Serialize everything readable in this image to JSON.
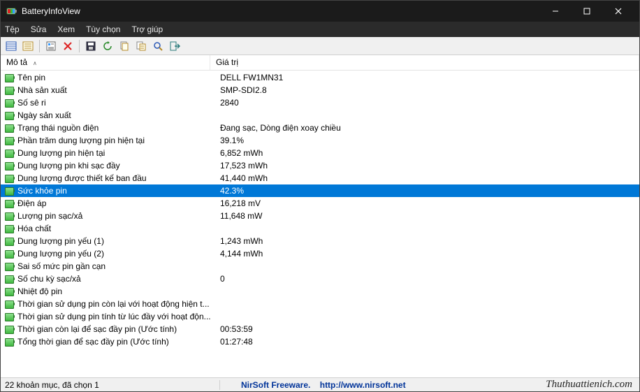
{
  "window": {
    "title": "BatteryInfoView"
  },
  "menu": {
    "file": "Tệp",
    "edit": "Sửa",
    "view": "Xem",
    "options": "Tùy chọn",
    "help": "Trợ giúp"
  },
  "columns": {
    "description": "Mô tả",
    "value": "Giá trị"
  },
  "rows": [
    {
      "desc": "Tên pin",
      "val": "DELL FW1MN31"
    },
    {
      "desc": "Nhà sản xuất",
      "val": "SMP-SDI2.8"
    },
    {
      "desc": "Số sê ri",
      "val": " 2840"
    },
    {
      "desc": "Ngày sản xuất",
      "val": ""
    },
    {
      "desc": "Trạng thái nguồn điện",
      "val": "Đang sạc, Dòng điện xoay chiều"
    },
    {
      "desc": "Phần trăm dung lượng pin hiện tại",
      "val": "39.1%"
    },
    {
      "desc": "Dung lượng pin hiện tại",
      "val": "6,852 mWh"
    },
    {
      "desc": "Dung lượng pin khi sạc đầy",
      "val": "17,523 mWh"
    },
    {
      "desc": "Dung lượng được thiết kế ban đầu",
      "val": "41,440 mWh"
    },
    {
      "desc": "Sức khỏe pin",
      "val": "42.3%",
      "selected": true
    },
    {
      "desc": "Điện áp",
      "val": "16,218 mV"
    },
    {
      "desc": "Lượng pin sạc/xả",
      "val": "11,648 mW"
    },
    {
      "desc": "Hóa chất",
      "val": ""
    },
    {
      "desc": "Dung lượng pin yếu (1)",
      "val": "1,243 mWh"
    },
    {
      "desc": "Dung lượng pin yếu (2)",
      "val": "4,144 mWh"
    },
    {
      "desc": "Sai số mức pin gần cạn",
      "val": ""
    },
    {
      "desc": "Số chu kỳ sạc/xả",
      "val": "0"
    },
    {
      "desc": "Nhiệt độ pin",
      "val": ""
    },
    {
      "desc": "Thời gian sử dụng pin còn lại với hoạt động hiện t...",
      "val": ""
    },
    {
      "desc": "Thời gian sử dụng pin tính từ lúc đầy với hoạt độn...",
      "val": ""
    },
    {
      "desc": "Thời gian còn lại để sạc đầy pin (Ước tính)",
      "val": "00:53:59"
    },
    {
      "desc": "Tổng thời gian để sạc đầy pin (Ước tính)",
      "val": "01:27:48"
    }
  ],
  "status": {
    "left": "22 khoản mục, đã chọn 1",
    "freeware_label": "NirSoft Freeware.",
    "url": "http://www.nirsoft.net",
    "watermark": "Thuthuattienich.com"
  }
}
